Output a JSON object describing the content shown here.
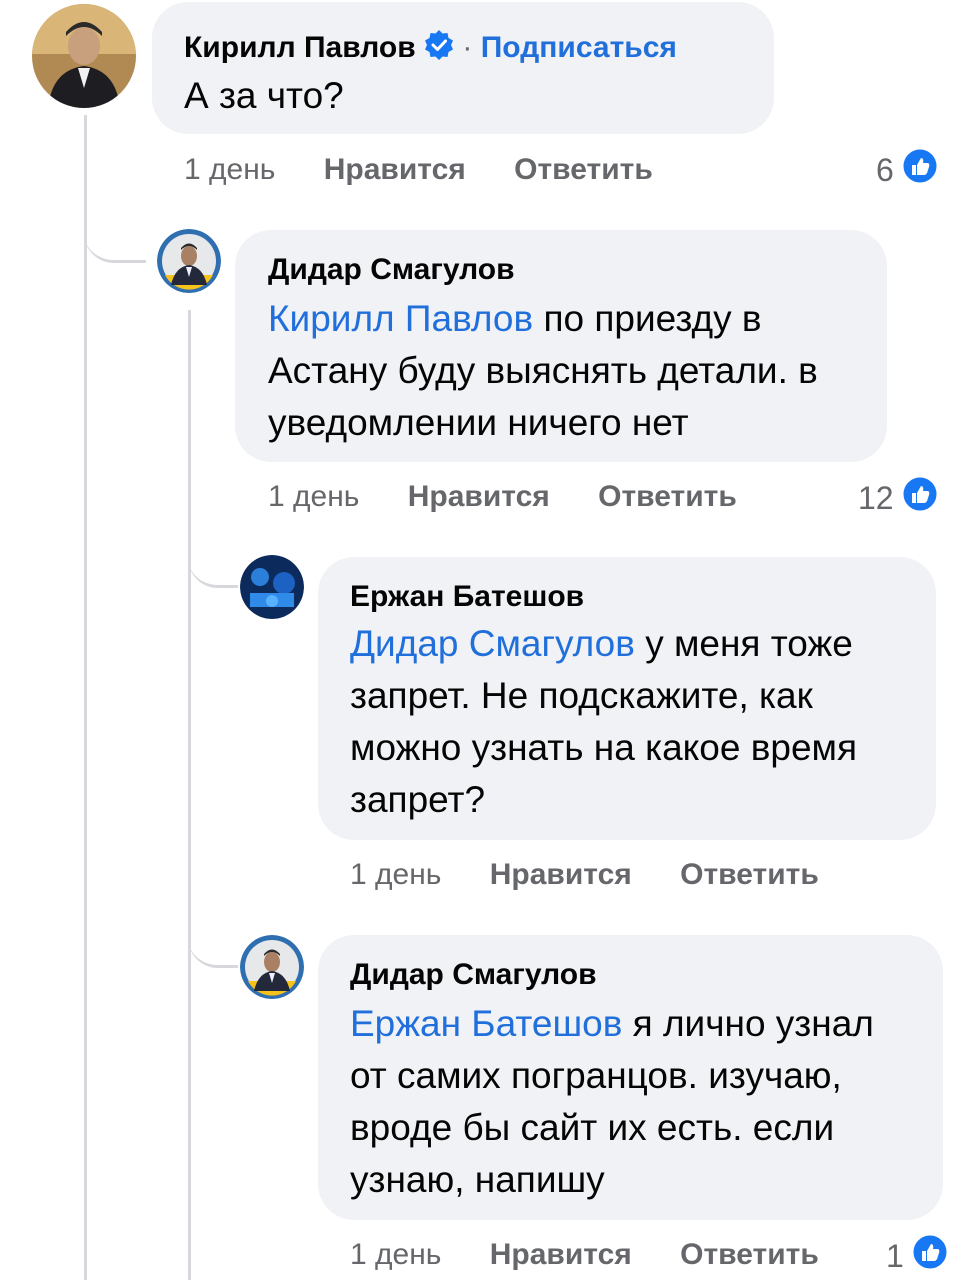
{
  "comments": [
    {
      "author": "Кирилл Павлов",
      "follow_separator": "·",
      "follow_label": "Подписаться",
      "text": "А за что?",
      "time": "1 день",
      "like_label": "Нравится",
      "reply_label": "Ответить",
      "reaction_count": "6",
      "reaction_icon": "like-icon",
      "verified_icon": "verified-badge-icon"
    },
    {
      "author": "Дидар Смагулов",
      "mention": "Кирилл Павлов",
      "text_lines": [
        "по приезду в",
        "Астану буду выяснять детали. в",
        "уведомлении ничего нет"
      ],
      "time": "1 день",
      "like_label": "Нравится",
      "reply_label": "Ответить",
      "reaction_count": "12",
      "reaction_icon": "like-icon"
    },
    {
      "author": "Ержан Батешов",
      "mention": "Дидар Смагулов",
      "text_lines": [
        "у меня тоже",
        "запрет. Не подскажите, как",
        "можно узнать на какое время",
        "запрет?"
      ],
      "time": "1 день",
      "like_label": "Нравится",
      "reply_label": "Ответить"
    },
    {
      "author": "Дидар Смагулов",
      "mention": "Ержан Батешов",
      "text_lines": [
        "я лично узнал",
        "от самих погранцов. изучаю,",
        "вроде бы сайт их есть. если",
        "узнаю, напишу"
      ],
      "time": "1 день",
      "like_label": "Нравится",
      "reply_label": "Ответить",
      "reaction_count": "1",
      "reaction_icon": "like-icon"
    }
  ],
  "colors": {
    "bubble": "#f0f2f5",
    "mention": "#216fdb",
    "meta": "#65676b",
    "like": "#1877f2"
  }
}
